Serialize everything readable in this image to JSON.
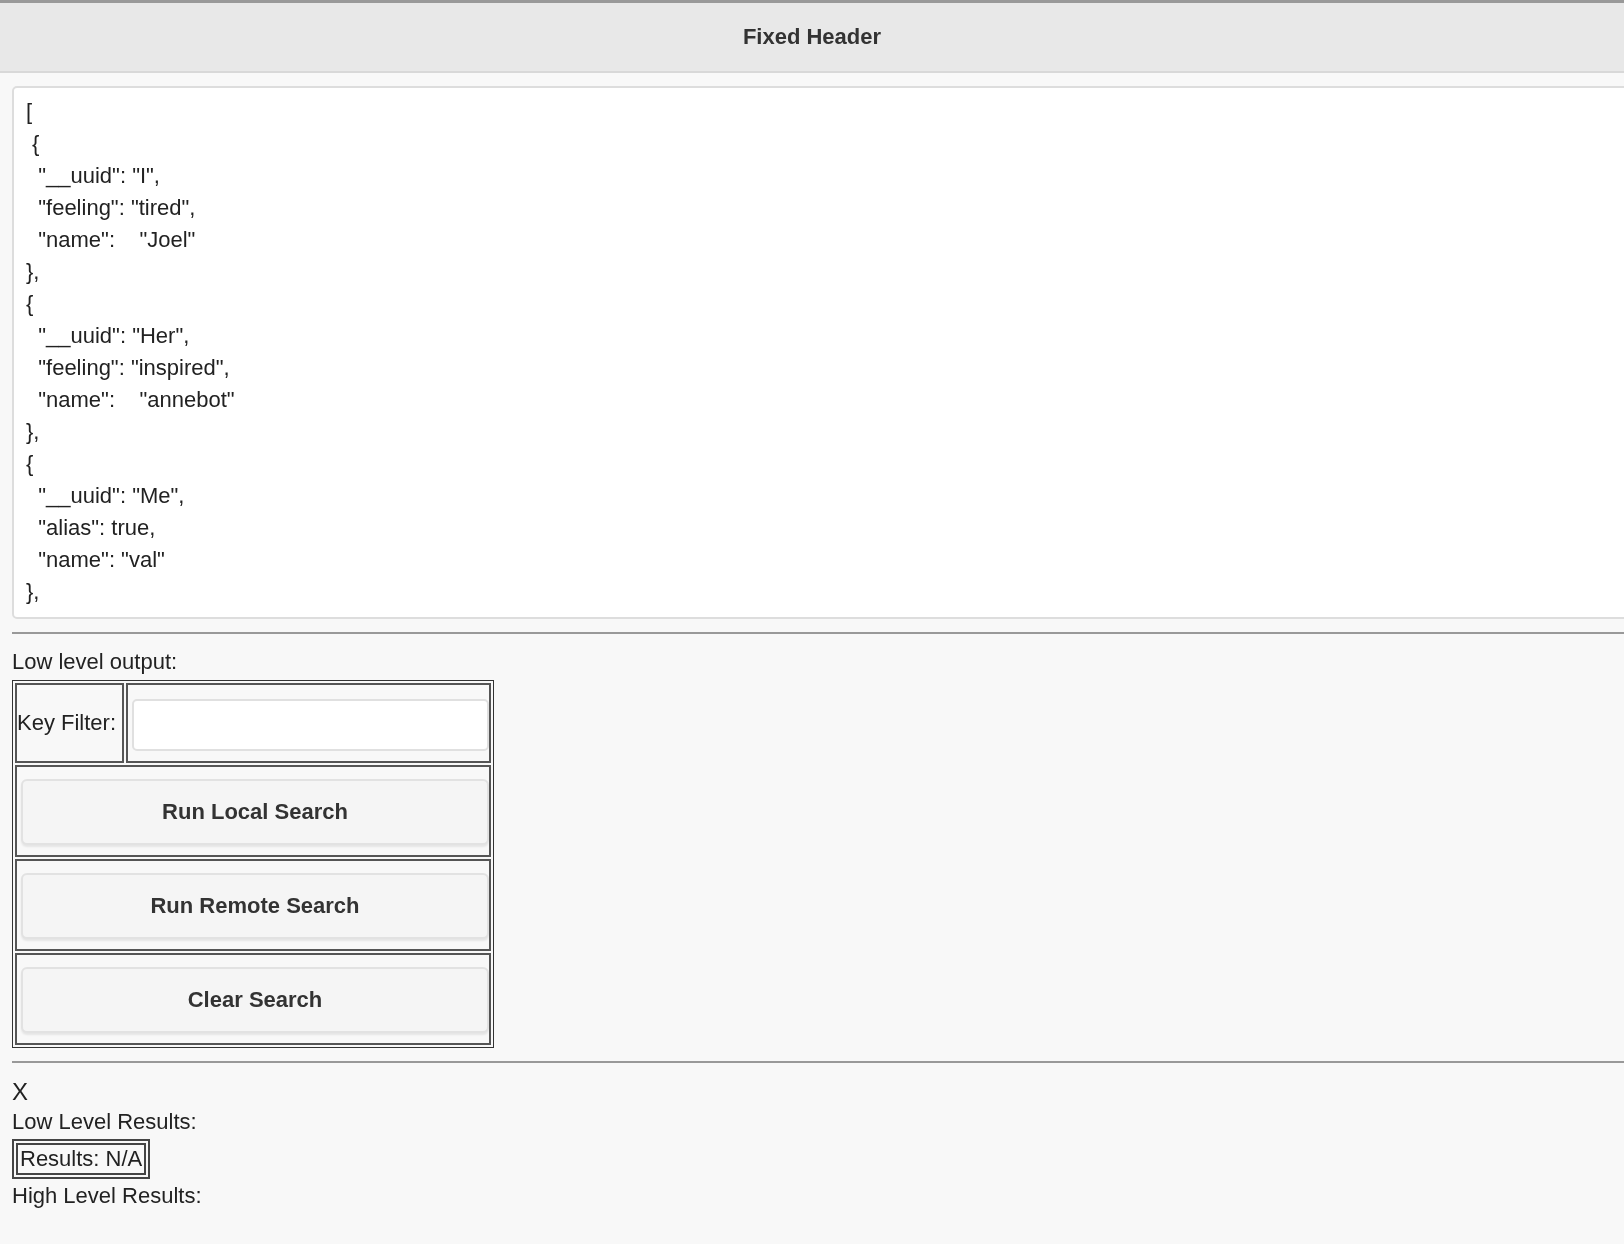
{
  "header": {
    "title": "Fixed Header"
  },
  "editor": {
    "value": "[\n {\n  \"__uuid\": \"I\",\n  \"feeling\": \"tired\",\n  \"name\":    \"Joel\"\n},\n{\n  \"__uuid\": \"Her\",\n  \"feeling\": \"inspired\",\n  \"name\":    \"annebot\"\n},\n{\n  \"__uuid\": \"Me\",\n  \"alias\": true,\n  \"name\": \"val\"\n},"
  },
  "low_level_output": {
    "label": "Low level output:",
    "key_filter": {
      "label": "Key Filter:"
    },
    "buttons": [
      "Run Local Search",
      "Run Remote Search",
      "Clear Search"
    ]
  },
  "mark": "X",
  "low_level_results": {
    "label": "Low Level Results:",
    "cells": [
      "Results: N/A"
    ]
  },
  "high_level_results": {
    "label": "High Level Results:"
  }
}
